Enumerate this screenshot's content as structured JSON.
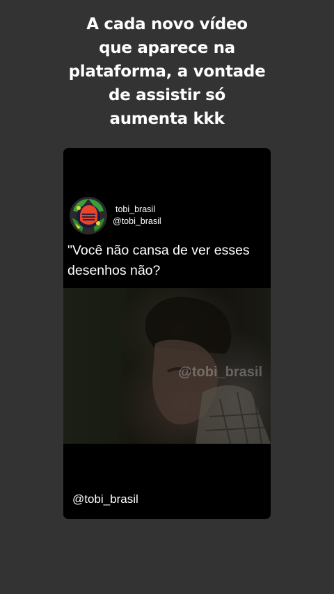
{
  "caption": "A cada novo vídeo\nque aparece na\nplataforma, a vontade\nde assistir só\naumenta kkk",
  "post": {
    "display_name": "tobi_brasil",
    "handle": "@tobi_brasil",
    "quote": "\"Você não cansa de ver esses desenhos não?",
    "video_watermark": "@tobi_brasil",
    "footer_handle": "@tobi_brasil"
  },
  "icons": {
    "avatar": "profile-avatar-icon"
  }
}
